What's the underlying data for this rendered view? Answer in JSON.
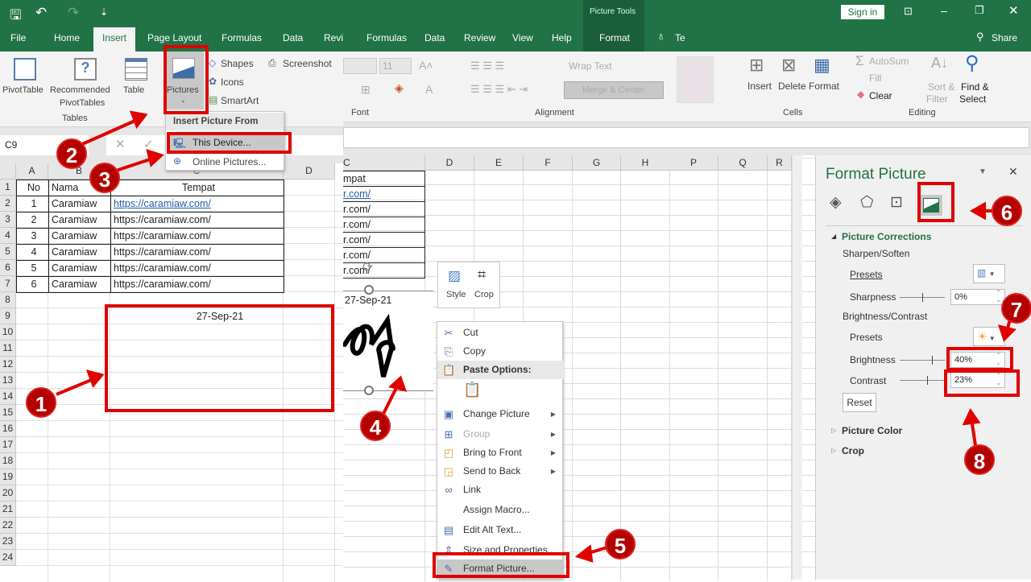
{
  "titlebar": {
    "context_title": "Picture Tools",
    "sign_in": "Sign in",
    "qat_icons": [
      "save-icon",
      "undo-icon",
      "redo-icon",
      "customize-icon"
    ]
  },
  "tabs_left": [
    "File",
    "Home",
    "Insert",
    "Page Layout",
    "Formulas",
    "Data",
    "Revi"
  ],
  "tabs_right": [
    "Formulas",
    "Data",
    "Review",
    "View",
    "Help",
    "Format",
    "Te"
  ],
  "share": "Share",
  "ribbon_left": {
    "pivottable": "PivotTable",
    "recommended": "Recommended",
    "pivottables": "PivotTables",
    "table": "Table",
    "group_tables": "Tables",
    "pictures": "Pictures",
    "shapes": "Shapes",
    "icons": "Icons",
    "smartart": "SmartArt",
    "screenshot": "Screenshot"
  },
  "pictures_menu": {
    "header": "Insert Picture From",
    "this_device": "This Device...",
    "online": "Online Pictures..."
  },
  "ribbon_right": {
    "font_size": "11",
    "font_group": "Font",
    "wrap_text": "Wrap Text",
    "merge_center": "Merge & Center",
    "alignment_group": "Alignment",
    "insert": "Insert",
    "delete": "Delete",
    "format": "Format",
    "cells_group": "Cells",
    "autosum": "AutoSum",
    "fill": "Fill",
    "clear": "Clear",
    "sort": "Sort &",
    "filter": "Filter",
    "find": "Find &",
    "select": "Select",
    "editing_group": "Editing"
  },
  "name_box": "C9",
  "left_sheet": {
    "columns": [
      "A",
      "B",
      "C",
      "D"
    ],
    "rows": [
      "1",
      "2",
      "3",
      "4",
      "5",
      "6",
      "7",
      "8",
      "9",
      "10",
      "11",
      "12",
      "13",
      "14",
      "15",
      "16",
      "17",
      "18",
      "19",
      "20",
      "21",
      "22",
      "23",
      "24"
    ],
    "header": [
      "No",
      "Nama",
      "Tempat"
    ],
    "data": [
      [
        "1",
        "Caramiaw",
        "https://caramiaw.com/"
      ],
      [
        "2",
        "Caramiaw",
        "https://caramiaw.com/"
      ],
      [
        "3",
        "Caramiaw",
        "https://caramiaw.com/"
      ],
      [
        "4",
        "Caramiaw",
        "https://caramiaw.com/"
      ],
      [
        "5",
        "Caramiaw",
        "https://caramiaw.com/"
      ],
      [
        "6",
        "Caramiaw",
        "https://caramiaw.com/"
      ]
    ],
    "date": "27-Sep-21"
  },
  "right_sheet": {
    "columns": [
      "C",
      "D",
      "E",
      "F",
      "G",
      "H",
      "P",
      "Q",
      "R"
    ],
    "fragments": [
      "mpat",
      "r.com/",
      "r.com/",
      "r.com/",
      "r.com/",
      "r.com/",
      "r.com/"
    ],
    "date": "27-Sep-21"
  },
  "mini_toolbar": {
    "style": "Style",
    "crop": "Crop"
  },
  "context_menu": [
    {
      "label": "Cut",
      "icon": "scissors-icon",
      "glyph": "✂"
    },
    {
      "label": "Copy",
      "icon": "copy-icon",
      "glyph": "⎘"
    },
    {
      "label": "Paste Options:",
      "icon": "paste-icon",
      "glyph": "📋",
      "bold": true
    },
    {
      "label": "",
      "icon": "paste-picture-icon",
      "glyph": "📋"
    },
    {
      "label": "Change Picture",
      "icon": "change-picture-icon",
      "glyph": "▣",
      "submenu": true
    },
    {
      "label": "Group",
      "icon": "group-icon",
      "glyph": "⊞",
      "submenu": true,
      "disabled": true
    },
    {
      "label": "Bring to Front",
      "icon": "bring-front-icon",
      "glyph": "◰",
      "submenu": true
    },
    {
      "label": "Send to Back",
      "icon": "send-back-icon",
      "glyph": "◲",
      "submenu": true
    },
    {
      "label": "Link",
      "icon": "link-icon",
      "glyph": "∞"
    },
    {
      "label": "Assign Macro...",
      "icon": "",
      "glyph": ""
    },
    {
      "label": "Edit Alt Text...",
      "icon": "alt-text-icon",
      "glyph": "▤"
    },
    {
      "label": "Size and Properties...",
      "icon": "size-icon",
      "glyph": "⇕"
    },
    {
      "label": "Format Picture...",
      "icon": "format-picture-icon",
      "glyph": "✎",
      "highlight": true
    }
  ],
  "format_pane": {
    "title": "Format Picture",
    "section": "Picture Corrections",
    "sharpen": "Sharpen/Soften",
    "presets": "Presets",
    "sharpness": "Sharpness",
    "sharpness_value": "0%",
    "brightness_contrast": "Brightness/Contrast",
    "presets2": "Presets",
    "brightness": "Brightness",
    "brightness_value": "40%",
    "contrast": "Contrast",
    "contrast_value": "23%",
    "reset": "Reset",
    "picture_color": "Picture Color",
    "crop": "Crop"
  },
  "steps": [
    "1",
    "2",
    "3",
    "4",
    "5",
    "6",
    "7",
    "8"
  ],
  "colors": {
    "excel_green": "#217346",
    "annotation_red": "#e00000",
    "section_green": "#217346"
  }
}
